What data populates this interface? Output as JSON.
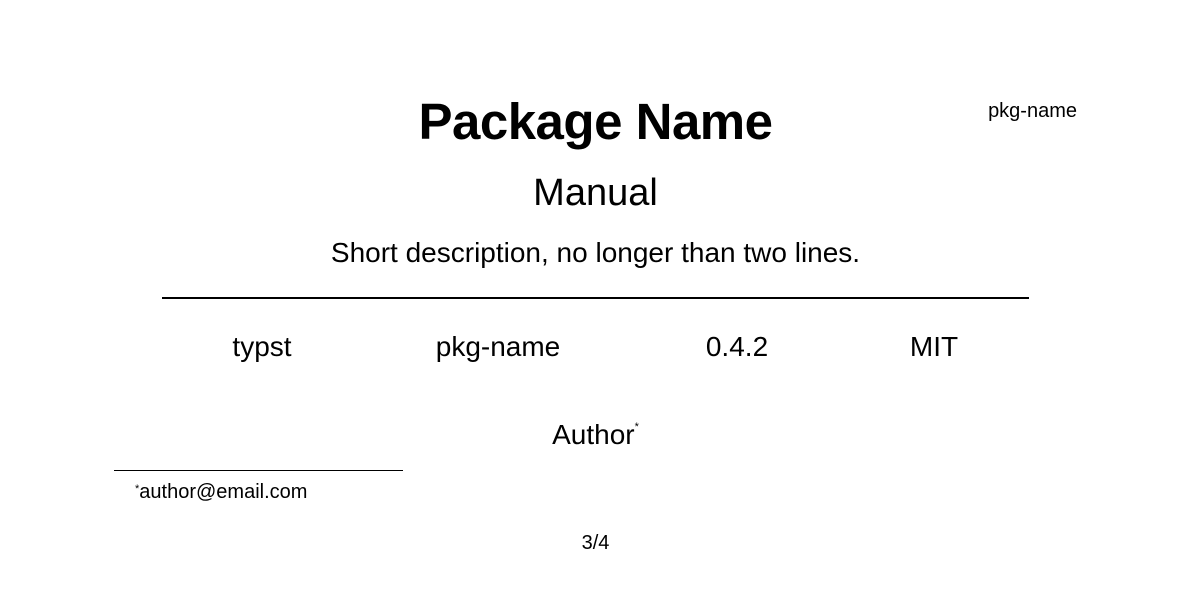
{
  "header": {
    "package_id": "pkg-name"
  },
  "title": "Package Name",
  "subtitle": "Manual",
  "description": "Short description, no longer than two lines.",
  "meta": {
    "language": "typst",
    "package": "pkg-name",
    "version": "0.4.2",
    "license": "MIT"
  },
  "author": {
    "name": "Author",
    "marker": "*"
  },
  "footnote": {
    "marker": "*",
    "text": "author@email.com"
  },
  "page": {
    "number": "3/4"
  }
}
